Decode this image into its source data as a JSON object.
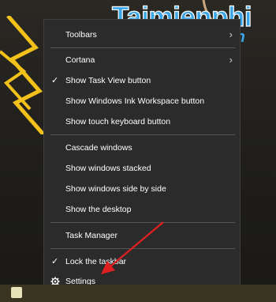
{
  "watermark": {
    "main": "Taimienphi",
    "sub": ".vn"
  },
  "menu": {
    "toolbars": "Toolbars",
    "cortana": "Cortana",
    "show_task_view": "Show Task View button",
    "show_ink": "Show Windows Ink Workspace button",
    "show_touch_keyboard": "Show touch keyboard button",
    "cascade": "Cascade windows",
    "stacked": "Show windows stacked",
    "side_by_side": "Show windows side by side",
    "show_desktop": "Show the desktop",
    "task_manager": "Task Manager",
    "lock_taskbar": "Lock the taskbar",
    "settings": "Settings",
    "check_glyph": "✓",
    "chevron_glyph": "›"
  },
  "icons": {
    "submenu": "chevron-right-icon",
    "checked": "checkmark-icon",
    "settings": "gear-icon",
    "start": "windows-start-icon"
  },
  "colors": {
    "menu_bg": "#2b2b2b",
    "accent_watermark": "#3aa6e8",
    "bolt": "#f2c21b",
    "annotation_arrow": "#e02020"
  }
}
